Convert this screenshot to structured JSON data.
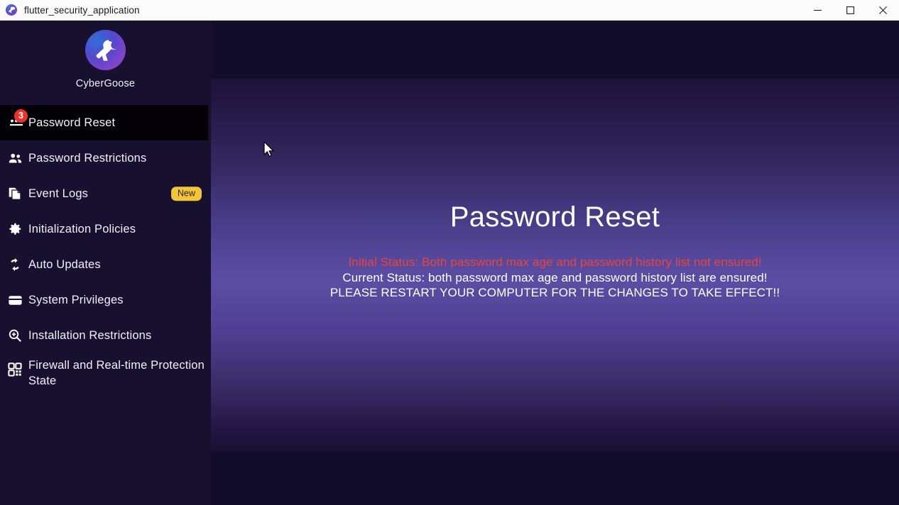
{
  "window": {
    "title": "flutter_security_application",
    "app_icon": "cybergoose-logo-icon",
    "controls": {
      "minimize": "minimize-icon",
      "maximize": "maximize-icon",
      "close": "close-icon"
    }
  },
  "sidebar": {
    "brand_name": "CyberGoose",
    "brand_logo": "cybergoose-logo-icon",
    "items": [
      {
        "label": "Password Reset",
        "icon": "password-dots-icon",
        "selected": true,
        "badge_count": "3"
      },
      {
        "label": "Password Restrictions",
        "icon": "people-icon",
        "selected": false
      },
      {
        "label": "Event Logs",
        "icon": "documents-copy-icon",
        "selected": false,
        "badge_new": "New"
      },
      {
        "label": "Initialization Policies",
        "icon": "gear-icon",
        "selected": false
      },
      {
        "label": "Auto Updates",
        "icon": "sync-refresh-icon",
        "selected": false
      },
      {
        "label": "System Privileges",
        "icon": "card-icon",
        "selected": false
      },
      {
        "label": "Installation Restrictions",
        "icon": "magnifier-plus-icon",
        "selected": false
      },
      {
        "label": "Firewall and Real-time Protection State",
        "icon": "qr-blocks-icon",
        "selected": false
      }
    ]
  },
  "main": {
    "title": "Password Reset",
    "status": {
      "initial": "Initial Status: Both password max age and password history list not ensured!",
      "current": "Current Status: both password max age and password history list are ensured!",
      "restart": "PLEASE RESTART YOUR COMPUTER FOR THE CHANGES TO TAKE EFFECT!!"
    }
  },
  "colors": {
    "badge_red": "#e8332a",
    "badge_new_yellow": "#f2c53d",
    "status_error_red": "#e8453c",
    "sidebar_bg": "#17102f",
    "selected_bg": "#050207"
  }
}
